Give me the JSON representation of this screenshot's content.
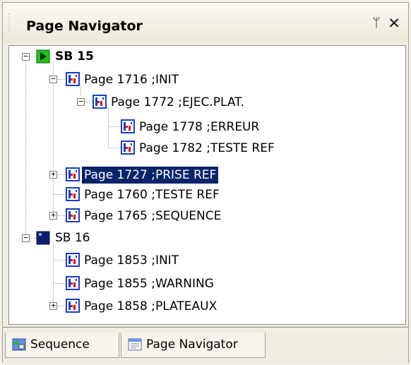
{
  "panel": {
    "title": "Page Navigator"
  },
  "tree": {
    "nodes": [
      {
        "label": "SB 15",
        "kind": "sb-run",
        "bold": true
      },
      {
        "label": "Page 1716 ;INIT",
        "kind": "page"
      },
      {
        "label": "Page 1772 ;EJEC.PLAT.",
        "kind": "page"
      },
      {
        "label": "Page 1778 ;ERREUR",
        "kind": "page"
      },
      {
        "label": "Page 1782 ;TESTE REF",
        "kind": "page"
      },
      {
        "label": "Page 1727 ;PRISE REF",
        "kind": "page",
        "selected": true
      },
      {
        "label": "Page 1760 ;TESTE REF",
        "kind": "page"
      },
      {
        "label": "Page 1765 ;SEQUENCE",
        "kind": "page"
      },
      {
        "label": "SB 16",
        "kind": "sb-stop"
      },
      {
        "label": "Page 1853 ;INIT",
        "kind": "page"
      },
      {
        "label": "Page 1855 ;WARNING",
        "kind": "page"
      },
      {
        "label": "Page 1858 ;PLATEAUX",
        "kind": "page"
      }
    ]
  },
  "tabs": [
    {
      "label": "Sequence",
      "icon": "sequence-icon"
    },
    {
      "label": "Page Navigator",
      "icon": "page-navigator-icon",
      "active": true
    }
  ],
  "colors": {
    "selection": "#0a246a",
    "run_green": "#19c519",
    "stop_navy": "#0b1f6e",
    "page_icon_blue": "#1a3cc8",
    "page_icon_red": "#d81010"
  },
  "icons": {
    "pin": "pin-icon",
    "close": "close-icon"
  },
  "glyphs": {
    "pin": "ᛘ",
    "close": "✕",
    "plus": "+",
    "minus": "−"
  }
}
